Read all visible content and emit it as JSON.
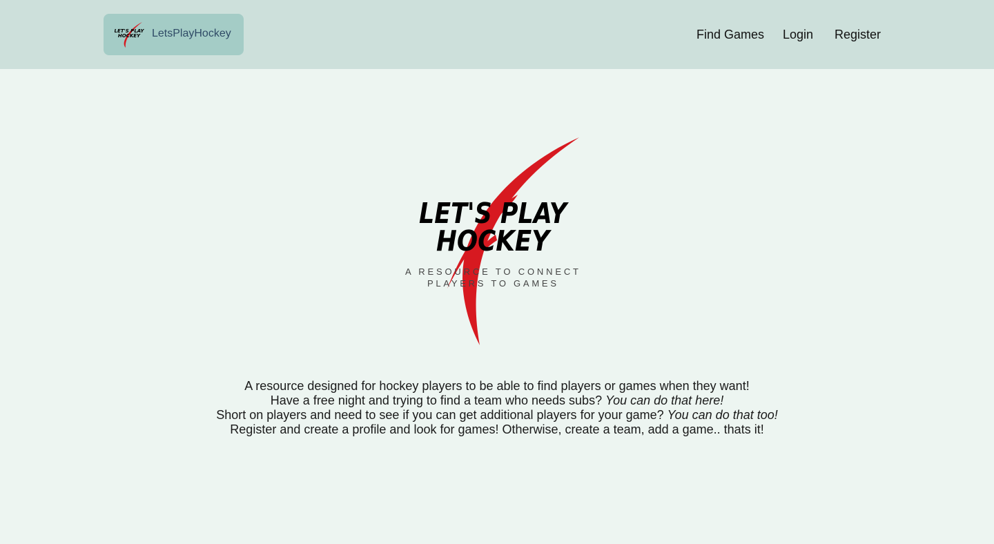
{
  "header": {
    "brand_name": "LetsPlayHockey",
    "brand_logo_text_line1": "LET'S PLAY",
    "brand_logo_text_line2": "HOCKEY",
    "nav": {
      "find_games": "Find Games",
      "login": "Login",
      "register": "Register"
    }
  },
  "hero": {
    "title_line1": "LET'S PLAY",
    "title_line2": "HOCKEY",
    "tagline_line1": "A RESOURCE TO CONNECT",
    "tagline_line2": "PLAYERS TO GAMES"
  },
  "description": {
    "line1": "A resource designed for hockey players to be able to find players or games when they want!",
    "line2_text": "Have a free night and trying to find a team who needs subs? ",
    "line2_emphasis": "You can do that here!",
    "line3_text": "Short on players and need to see if you can get additional players for your game? ",
    "line3_emphasis": "You can do that too!",
    "line4": "Register and create a profile and look for games! Otherwise, create a team, add a game.. thats it!"
  },
  "colors": {
    "header_bg": "#cde0db",
    "brand_bg": "#a4ccc6",
    "page_bg": "#edf5f1",
    "accent_red": "#d71920"
  }
}
